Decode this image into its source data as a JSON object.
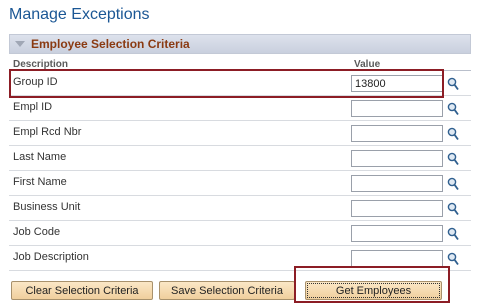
{
  "page": {
    "title": "Manage Exceptions"
  },
  "panel": {
    "title": "Employee Selection Criteria",
    "columns": {
      "description": "Description",
      "value": "Value"
    },
    "rows": [
      {
        "label": "Group ID",
        "value": "13800"
      },
      {
        "label": "Empl ID",
        "value": ""
      },
      {
        "label": "Empl Rcd Nbr",
        "value": ""
      },
      {
        "label": "Last Name",
        "value": ""
      },
      {
        "label": "First Name",
        "value": ""
      },
      {
        "label": "Business Unit",
        "value": ""
      },
      {
        "label": "Job Code",
        "value": ""
      },
      {
        "label": "Job Description",
        "value": ""
      }
    ]
  },
  "buttons": {
    "clear": "Clear Selection Criteria",
    "save": "Save Selection Criteria",
    "get": "Get Employees"
  },
  "icons": {
    "lookup": "magnifier-lookup-icon",
    "collapse": "collapse-triangle-icon"
  },
  "colors": {
    "title": "#1b5795",
    "panel_title": "#8a3a12",
    "highlight": "#8c1d25",
    "button": "#f0cf9d"
  }
}
